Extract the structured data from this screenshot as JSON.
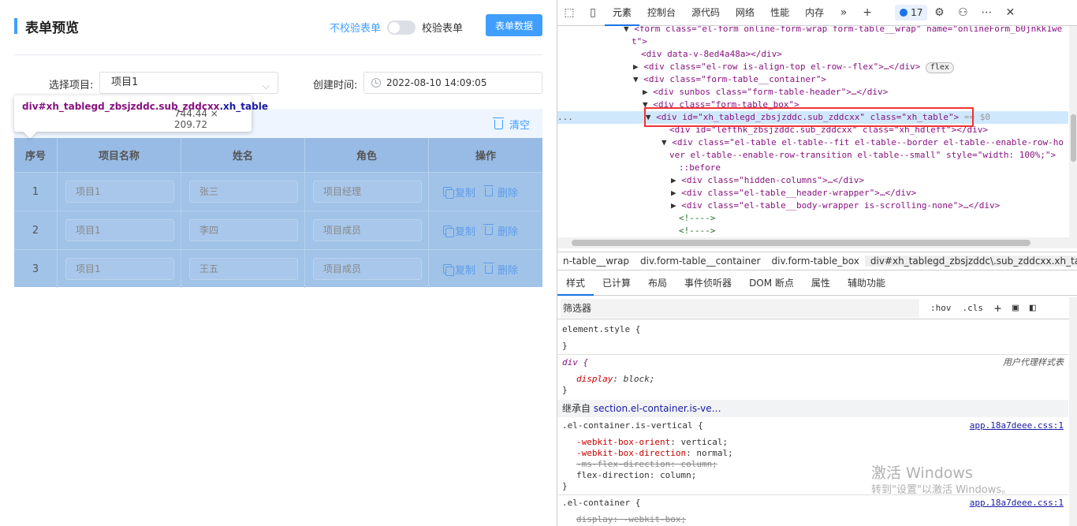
{
  "form": {
    "title": "表单预览",
    "no_verify_label": "不校验表单",
    "verify_label": "校验表单",
    "form_data_button": "表单数据",
    "project_label": "选择项目:",
    "project_value": "项目1",
    "created_label": "创建时间:",
    "created_value": "2022-08-10 14:09:05",
    "clear_label": "清空",
    "table": {
      "headers": [
        "序号",
        "项目名称",
        "姓名",
        "角色",
        "操作"
      ],
      "rows": [
        {
          "no": "1",
          "project": "项目1",
          "name": "张三",
          "role": "项目经理"
        },
        {
          "no": "2",
          "project": "项目1",
          "name": "李四",
          "role": "项目成员"
        },
        {
          "no": "3",
          "project": "项目1",
          "name": "王五",
          "role": "项目成员"
        }
      ],
      "copy_label": "复制",
      "delete_label": "删除"
    },
    "tooltip": {
      "tag": "div",
      "selector_id": "#xh_tablegd_zbsjzddc.sub_zddcxx",
      "selector_class": ".xh_table",
      "size": "744.44 × 209.72"
    }
  },
  "devtools": {
    "tabs": [
      "元素",
      "控制台",
      "源代码",
      "网络",
      "性能",
      "内存"
    ],
    "active_tab": "元素",
    "issues_count": "17",
    "dom_lines": [
      {
        "indent": 80,
        "arrow": "▼",
        "html": "form-line"
      },
      {
        "indent": 90,
        "arrow": "",
        "html": "datav-line"
      }
    ],
    "dom": {
      "l1": "<form class=\"el-form online-form-wrap form-table__wrap\" name=\"onlineForm_b0jnkk1we",
      "l1b": "t\">",
      "l2": "<div data-v-8ed4a48a></div>",
      "l3a": "<div class=\"el-row is-align-top el-row--flex\">…</div>",
      "l3flex": "flex",
      "l4": "<div class=\"form-table__container\">",
      "l5": "<div sunbos class=\"form-table-header\">…</div>",
      "l6": "<div class=\"form-table_box\">",
      "l7": "<div id=\"xh_tablegd_zbsjzddc.sub_zddcxx\" class=\"xh_table\">",
      "l7b": "== $0",
      "l8": "<div id=\"lefthk_zbsjzddc.sub_zddcxx\" class=\"xh_hdleft\"></div>",
      "l9": "<div class=\"el-table el-table--fit el-table--border el-table--enable-row-ho",
      "l9b": "ver el-table--enable-row-transition el-table--small\" style=\"width: 100%;\">",
      "l10": "::before",
      "l11": "<div class=\"hidden-columns\">…</div>",
      "l12": "<div class=\"el-table__header-wrapper\">…</div>",
      "l13": "<div class=\"el-table__body-wrapper is-scrolling-none\">…</div>",
      "l14": "<!---->",
      "l15": "<!---->",
      "dots": "..."
    },
    "breadcrumbs": [
      "n-table__wrap",
      "div.form-table__container",
      "div.form-table_box",
      "div#xh_tablegd_zbsjzddc\\.sub_zddcxx.xh_table"
    ],
    "styles_tabs": [
      "样式",
      "已计算",
      "布局",
      "事件侦听器",
      "DOM 断点",
      "属性",
      "辅助功能"
    ],
    "filter_placeholder": "筛选器",
    "hov": ":hov",
    "cls": ".cls",
    "styles": {
      "element_style": "element.style {",
      "close": "}",
      "div_sel": "div {",
      "ua_label": "用户代理样式表",
      "display_prop": "display",
      "display_val": "block;",
      "inherited_label": "继承自",
      "inherited_sel": "section.el-container.is-ve…",
      "vertical_sel": ".el-container.is-vertical {",
      "src1": "app.18a7deee.css:1",
      "p1": "-webkit-box-orient",
      "v1": "vertical;",
      "p2": "-webkit-box-direction",
      "v2": "normal;",
      "p3": "-ms-flex-direction: column;",
      "p4": "flex-direction",
      "v4": "column;",
      "container_sel": ".el-container {",
      "src2": "app.18a7deee.css:1",
      "p5": "display: -webkit-box;"
    },
    "watermark_line1": "激活 Windows",
    "watermark_line2": "转到\"设置\"以激活 Windows。"
  }
}
